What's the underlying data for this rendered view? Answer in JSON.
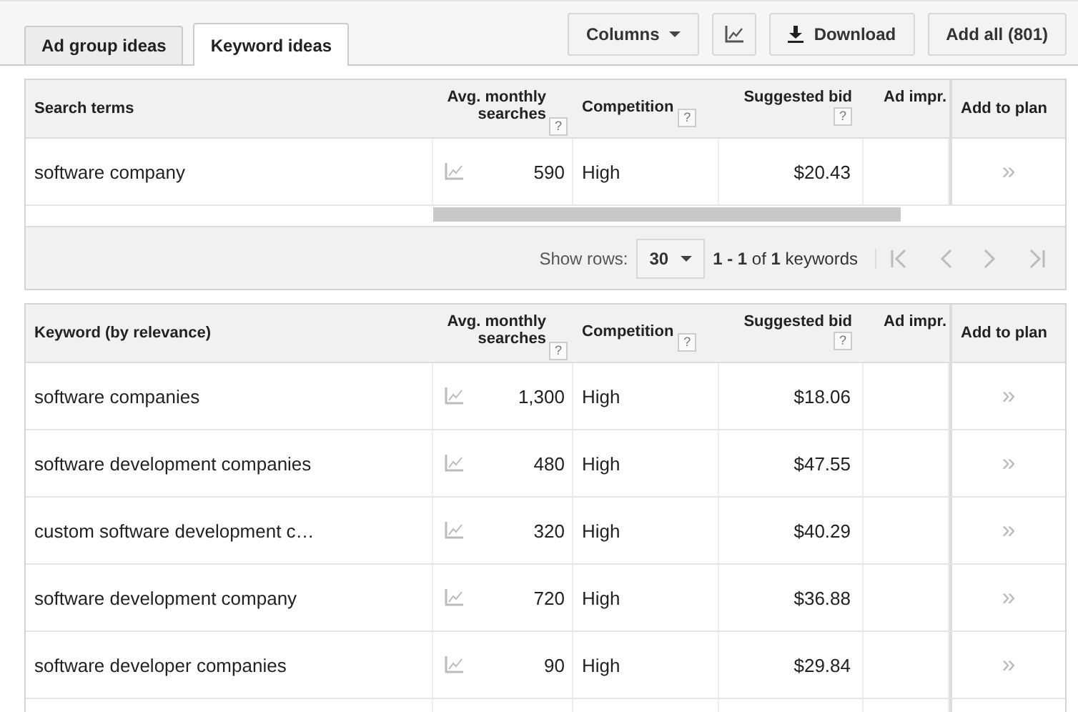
{
  "tabs": [
    {
      "label": "Ad group ideas",
      "selected": false
    },
    {
      "label": "Keyword ideas",
      "selected": true
    }
  ],
  "toolbar": {
    "columns_button": "Columns",
    "download_button": "Download",
    "add_all_button": "Add all (801)"
  },
  "search_table": {
    "columns": [
      {
        "label": "Search terms"
      },
      {
        "label": "Avg. monthly searches",
        "hint": "?"
      },
      {
        "label": "Competition",
        "hint": "?"
      },
      {
        "label": "Suggested bid",
        "hint": "?"
      },
      {
        "label": "Ad impr."
      },
      {
        "label": "Add to plan"
      }
    ],
    "rows": [
      {
        "keyword": "software company",
        "searches": "590",
        "competition": "High",
        "bid": "$20.43",
        "add": "»"
      }
    ],
    "pager": {
      "show_rows_label": "Show rows:",
      "rows_value": "30",
      "range": "**1 - 1** of **1** keywords"
    }
  },
  "keyword_table": {
    "columns": [
      {
        "label": "Keyword (by relevance)"
      },
      {
        "label": "Avg. monthly searches",
        "hint": "?"
      },
      {
        "label": "Competition",
        "hint": "?"
      },
      {
        "label": "Suggested bid",
        "hint": "?"
      },
      {
        "label": "Ad impr."
      },
      {
        "label": "Add to plan"
      }
    ],
    "rows": [
      {
        "keyword": "software companies",
        "searches": "1,300",
        "competition": "High",
        "bid": "$18.06",
        "add": "»"
      },
      {
        "keyword": "software development companies",
        "searches": "480",
        "competition": "High",
        "bid": "$47.55",
        "add": "»"
      },
      {
        "keyword": "custom software development c…",
        "searches": "320",
        "competition": "High",
        "bid": "$40.29",
        "add": "»"
      },
      {
        "keyword": "software development company",
        "searches": "720",
        "competition": "High",
        "bid": "$36.88",
        "add": "»"
      },
      {
        "keyword": "software developer companies",
        "searches": "90",
        "competition": "High",
        "bid": "$29.84",
        "add": "»"
      }
    ]
  }
}
